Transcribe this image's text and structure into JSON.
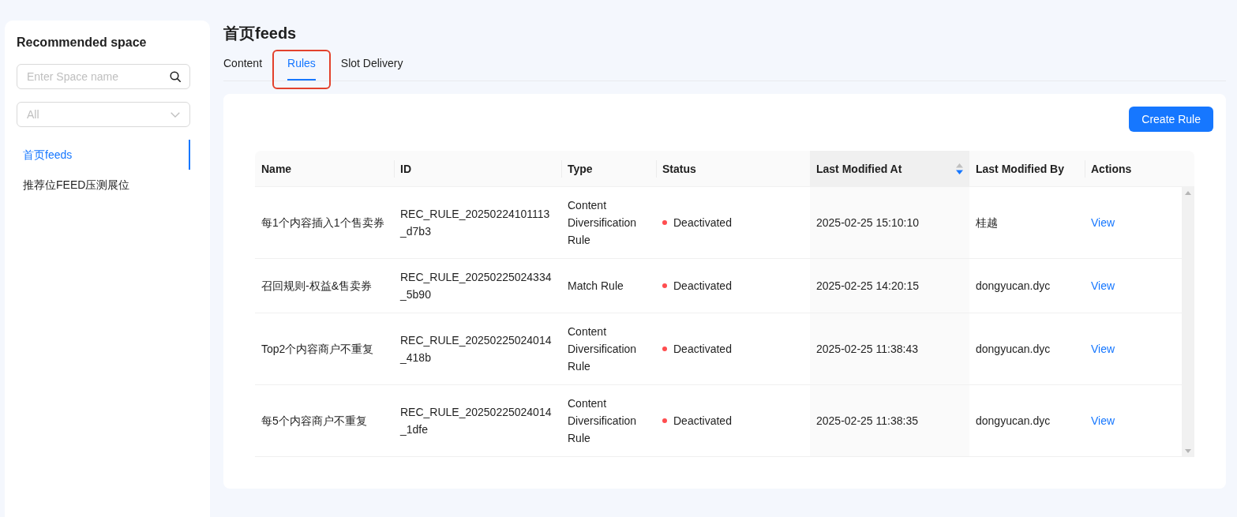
{
  "sidebar": {
    "title": "Recommended space",
    "search": {
      "placeholder": "Enter Space name"
    },
    "filter": {
      "placeholder": "All"
    },
    "items": [
      {
        "label": "首页feeds",
        "selected": true
      },
      {
        "label": "推荐位FEED压测展位",
        "selected": false
      }
    ]
  },
  "page": {
    "title": "首页feeds",
    "tabs": [
      {
        "label": "Content",
        "selected": false,
        "highlighted": false
      },
      {
        "label": "Rules",
        "selected": true,
        "highlighted": true
      },
      {
        "label": "Slot Delivery",
        "selected": false,
        "highlighted": false
      }
    ]
  },
  "toolbar": {
    "buttons": [
      "Create Rule"
    ]
  },
  "table": {
    "columns": [
      {
        "label": "Name",
        "sorted": false
      },
      {
        "label": "ID",
        "sorted": false
      },
      {
        "label": "Type",
        "sorted": false
      },
      {
        "label": "Status",
        "sorted": false
      },
      {
        "label": "Last Modified At",
        "sorted": true,
        "descending": true
      },
      {
        "label": "Last Modified By",
        "sorted": false
      },
      {
        "label": "Actions",
        "sorted": false
      }
    ],
    "rows": [
      {
        "name": "每1个内容插入1个售卖券",
        "id": "REC_RULE_20250224101113_d7b3",
        "type": "Content Diversification Rule",
        "status": {
          "label": "Deactivated",
          "color": "#ff4d4f"
        },
        "modified_at": "2025-02-25 15:10:10",
        "modified_by": "桂越",
        "action": "View"
      },
      {
        "name": "召回规则-权益&售卖券",
        "id": "REC_RULE_20250225024334_5b90",
        "type": "Match Rule",
        "status": {
          "label": "Deactivated",
          "color": "#ff4d4f"
        },
        "modified_at": "2025-02-25 14:20:15",
        "modified_by": "dongyucan.dyc",
        "action": "View"
      },
      {
        "name": "Top2个内容商户不重复",
        "id": "REC_RULE_20250225024014_418b",
        "type": "Content Diversification Rule",
        "status": {
          "label": "Deactivated",
          "color": "#ff4d4f"
        },
        "modified_at": "2025-02-25 11:38:43",
        "modified_by": "dongyucan.dyc",
        "action": "View"
      },
      {
        "name": "每5个内容商户不重复",
        "id": "REC_RULE_20250225024014_1dfe",
        "type": "Content Diversification Rule",
        "status": {
          "label": "Deactivated",
          "color": "#ff4d4f"
        },
        "modified_at": "2025-02-25 11:38:35",
        "modified_by": "dongyucan.dyc",
        "action": "View"
      }
    ]
  }
}
